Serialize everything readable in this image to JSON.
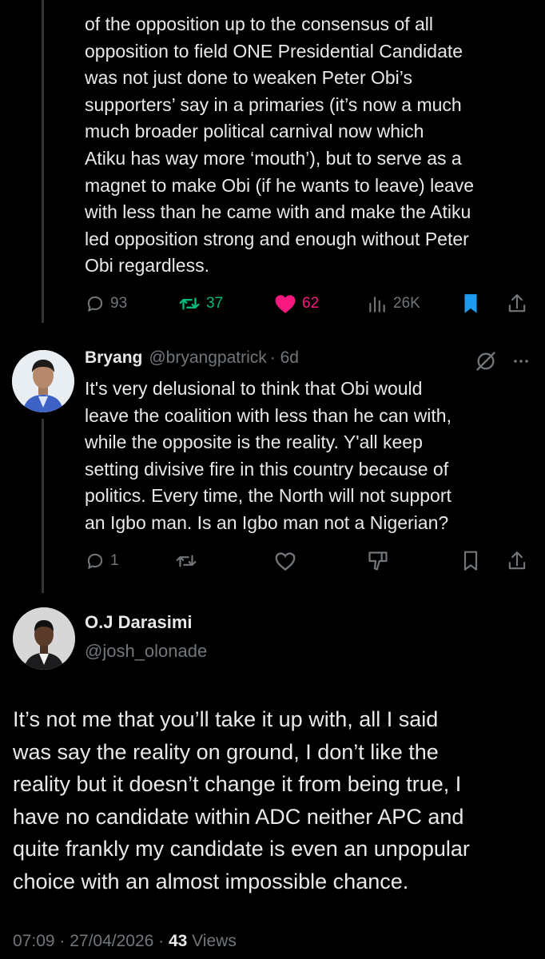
{
  "tweet1": {
    "text": "of the opposition up to the consensus of all\nopposition to field ONE Presidential Candidate\nwas not just done to weaken Peter Obi’s\nsupporters’ say in a primaries (it’s now a much\nmuch broader political carnival now which\nAtiku has way more ‘mouth’), but to serve as a\nmagnet to make Obi (if he wants to leave) leave\nwith less than he came with and make the Atiku\nled opposition strong and enough without Peter\nObi regardless.",
    "replies": "93",
    "reposts": "37",
    "likes": "62",
    "views": "26K",
    "icons": [
      "reply-icon",
      "repost-icon",
      "like-filled-icon",
      "views-icon",
      "bookmark-filled-icon",
      "share-icon"
    ],
    "colors": {
      "repost": "#00ba7c",
      "like": "#f91880",
      "bookmark": "#1d9bf0"
    }
  },
  "tweet2": {
    "name": "Bryang",
    "handle": "@bryangpatrick",
    "time": "· 6d",
    "text": "It's very delusional to think that Obi would\nleave the coalition with less than he can with,\nwhile the opposite is the reality. Y'all keep\nsetting divisive fire in this country because of\npolitics. Every time, the North will not support\nan Igbo man. Is an Igbo man not a Nigerian?",
    "replies": "1",
    "icons": [
      "grok-icon",
      "more-icon",
      "reply-icon",
      "repost-icon",
      "like-icon",
      "dislike-icon",
      "bookmark-icon",
      "share-icon"
    ]
  },
  "main": {
    "name": "O.J Darasimi",
    "handle": "@josh_olonade",
    "text": "It’s not me that you’ll take it up with, all I said\nwas say the reality on ground, I don’t like the\nreality but it doesn’t change it from being true, I\nhave no candidate within ADC neither APC and\nquite frankly my candidate is even an unpopular\nchoice with an almost impossible chance.",
    "timestamp": "07:09 · 27/04/2026 · ",
    "views_count": "43",
    "views_label": " Views"
  }
}
